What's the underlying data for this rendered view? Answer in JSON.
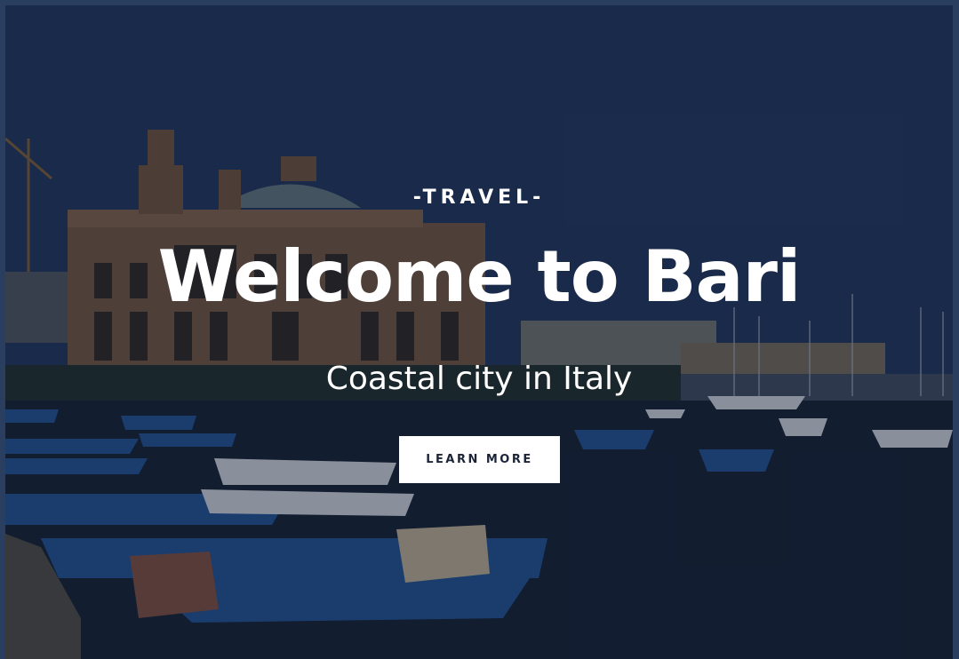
{
  "hero": {
    "eyebrow": "-TRAVEL-",
    "title": "Welcome to Bari",
    "subtitle": "Coastal city in Italy",
    "cta_label": "LEARN MORE"
  },
  "colors": {
    "overlay": "#1b2d4d",
    "text": "#ffffff",
    "button_bg": "#ffffff",
    "button_text": "#1c2438"
  }
}
